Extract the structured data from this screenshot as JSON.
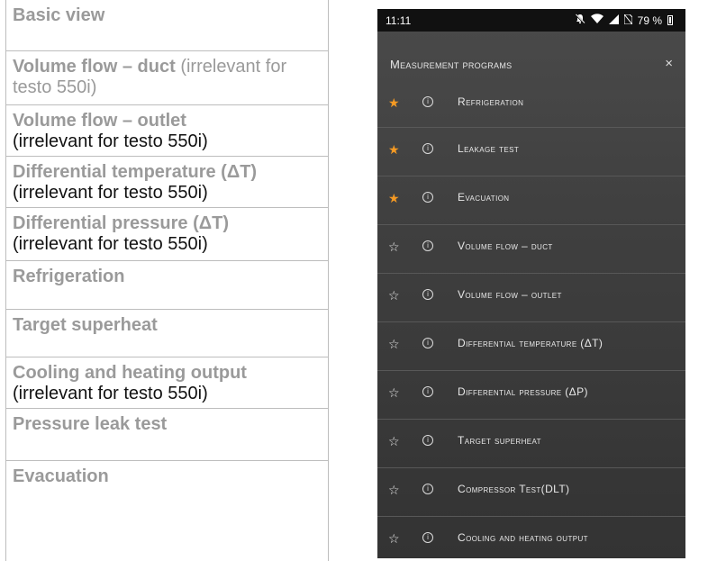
{
  "table": {
    "rows": [
      {
        "title": "Basic view",
        "note": ""
      },
      {
        "title": "Volume flow – duct",
        "title_suffix": " (irrelevant for testo 550i)",
        "note": ""
      },
      {
        "title": "Volume flow – outlet",
        "note": "(irrelevant for testo 550i)"
      },
      {
        "title": "Differential temperature (ΔT)",
        "note": "(irrelevant for testo 550i)"
      },
      {
        "title": "Differential pressure (ΔT)",
        "note": "(irrelevant for testo 550i)"
      },
      {
        "title": "Refrigeration",
        "note": ""
      },
      {
        "title": "Target superheat",
        "note": ""
      },
      {
        "title": "Cooling and heating output",
        "note": "(irrelevant for testo 550i)"
      },
      {
        "title": "Pressure leak test",
        "note": ""
      },
      {
        "title": "Evacuation",
        "note": ""
      }
    ]
  },
  "phone": {
    "status": {
      "time": "11:11",
      "mute_icon": "bell-off-icon",
      "wifi_icon": "wifi-icon",
      "signal_icon": "cell-signal-icon",
      "nosim_icon": "no-sim-icon",
      "battery_text": "79 %",
      "battery_level": 0.79
    },
    "header": {
      "title": "Measurement programs",
      "close": "×"
    },
    "items": [
      {
        "label": "Refrigeration",
        "favorite": true
      },
      {
        "label": "Leakage test",
        "favorite": true
      },
      {
        "label": "Evacuation",
        "favorite": true
      },
      {
        "label": "Volume flow – duct",
        "favorite": false
      },
      {
        "label": "Volume flow – outlet",
        "favorite": false
      },
      {
        "label": "Differential temperature (ΔT)",
        "favorite": false
      },
      {
        "label": "Differential pressure (ΔP)",
        "favorite": false
      },
      {
        "label": "Target superheat",
        "favorite": false
      },
      {
        "label": "Compressor Test(DLT)",
        "favorite": false
      },
      {
        "label": "Cooling and heating output",
        "favorite": false
      }
    ],
    "colors": {
      "favorite_star": "#f59a23",
      "background": "#3b3b3b"
    }
  }
}
